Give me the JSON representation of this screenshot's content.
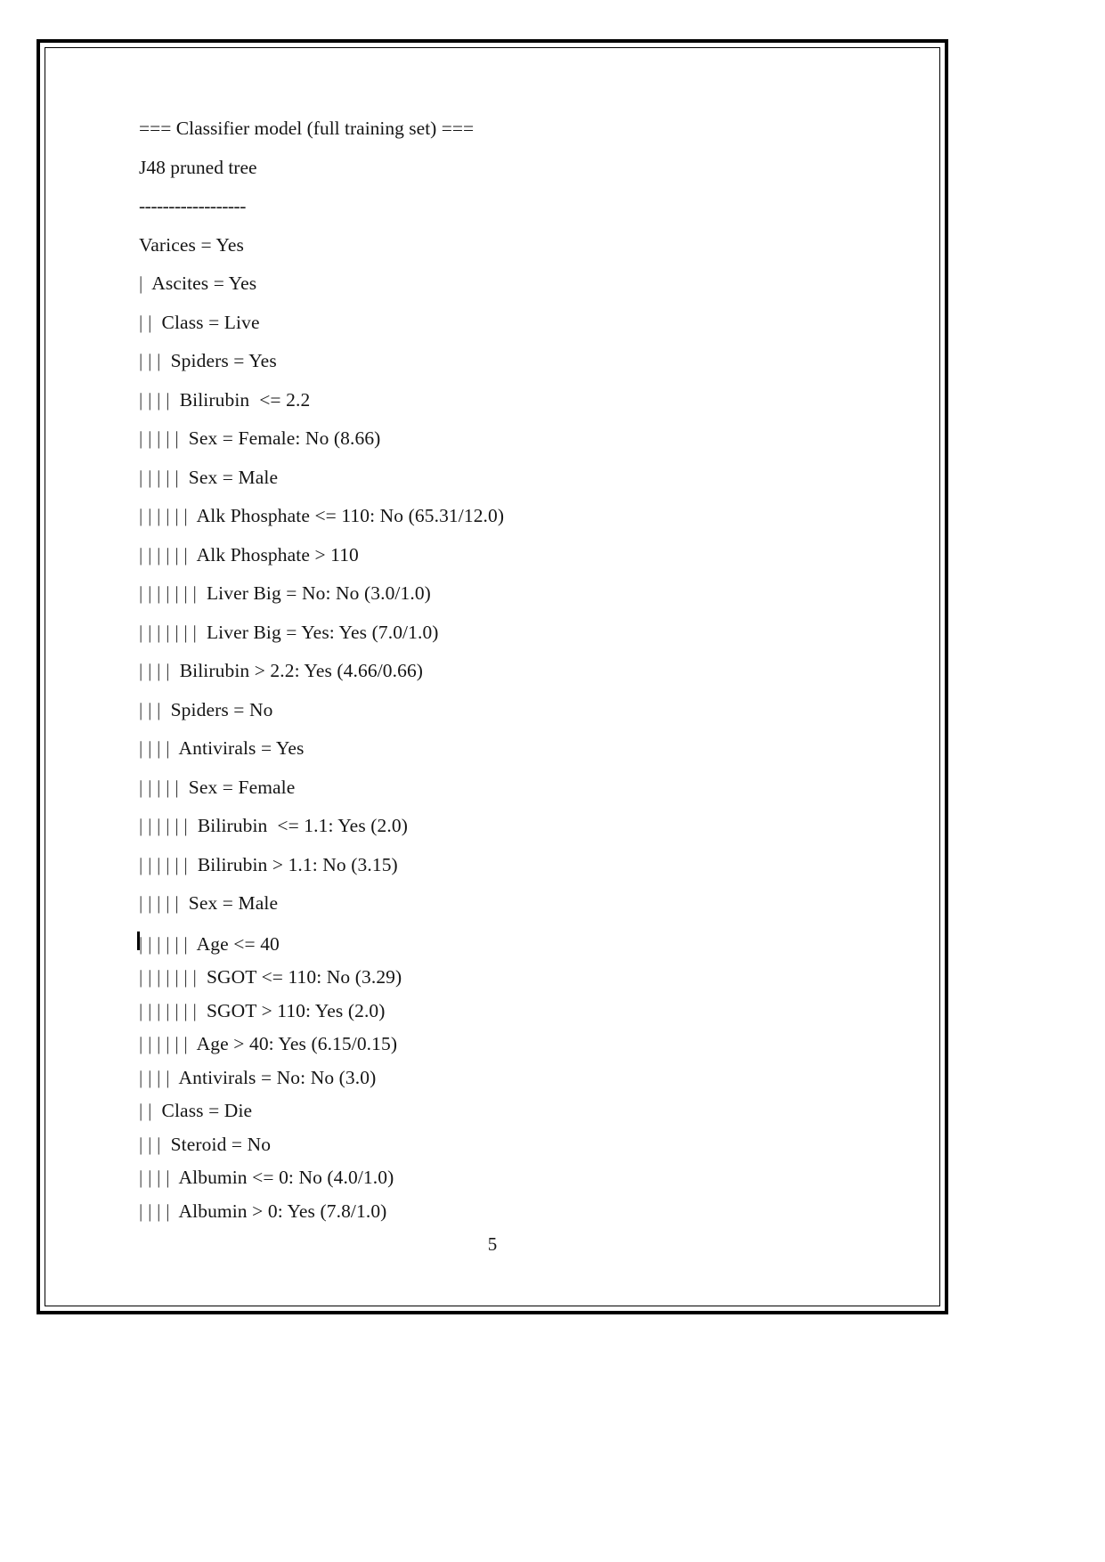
{
  "document": {
    "page_number": "5",
    "header_lines": [
      "=== Classifier model (full training set) ===",
      "J48 pruned tree"
    ],
    "separator": "------------------",
    "tree_lines": [
      {
        "pipes": "",
        "text": "Varices = Yes"
      },
      {
        "pipes": "|",
        "text": "Ascites = Yes"
      },
      {
        "pipes": "| |",
        "text": "Class = Live"
      },
      {
        "pipes": "| | |",
        "text": "Spiders = Yes"
      },
      {
        "pipes": "| | | |",
        "text": "Bilirubin  <= 2.2"
      },
      {
        "pipes": "| | | | |",
        "text": "Sex = Female: No (8.66)"
      },
      {
        "pipes": "| | | | |",
        "text": "Sex = Male"
      },
      {
        "pipes": "| | | | | |",
        "text": "Alk Phosphate <= 110: No (65.31/12.0)"
      },
      {
        "pipes": "| | | | | |",
        "text": "Alk Phosphate > 110"
      },
      {
        "pipes": "| | | | | | |",
        "text": "Liver Big = No: No (3.0/1.0)"
      },
      {
        "pipes": "| | | | | | |",
        "text": "Liver Big = Yes: Yes (7.0/1.0)"
      },
      {
        "pipes": "| | | |",
        "text": "Bilirubin > 2.2: Yes (4.66/0.66)"
      },
      {
        "pipes": "| | |",
        "text": "Spiders = No"
      },
      {
        "pipes": "| | | |",
        "text": "Antivirals = Yes"
      },
      {
        "pipes": "| | | | |",
        "text": "Sex = Female"
      },
      {
        "pipes": "| | | | | |",
        "text": "Bilirubin  <= 1.1: Yes (2.0)"
      },
      {
        "pipes": "| | | | | |",
        "text": "Bilirubin > 1.1: No (3.15)"
      },
      {
        "pipes": "| | | | |",
        "text": "Sex = Male"
      },
      {
        "pipes": "| | | | | |",
        "text": "Age <= 40",
        "cursor": true,
        "gap_before": true,
        "tight": true
      },
      {
        "pipes": "| | | | | | |",
        "text": "SGOT <= 110: No (3.29)",
        "tight": true
      },
      {
        "pipes": "| | | | | | |",
        "text": "SGOT > 110: Yes (2.0)",
        "tight": true
      },
      {
        "pipes": "| | | | | |",
        "text": "Age > 40: Yes (6.15/0.15)",
        "tight": true
      },
      {
        "pipes": "| | | |",
        "text": "Antivirals = No: No (3.0)",
        "tight": true
      },
      {
        "pipes": "| |",
        "text": "Class = Die",
        "tight": true
      },
      {
        "pipes": "| | |",
        "text": "Steroid = No",
        "tight": true
      },
      {
        "pipes": "| | | |",
        "text": "Albumin <= 0: No (4.0/1.0)",
        "tight": true
      },
      {
        "pipes": "| | | |",
        "text": "Albumin > 0: Yes (7.8/1.0)",
        "tight": true
      }
    ]
  }
}
